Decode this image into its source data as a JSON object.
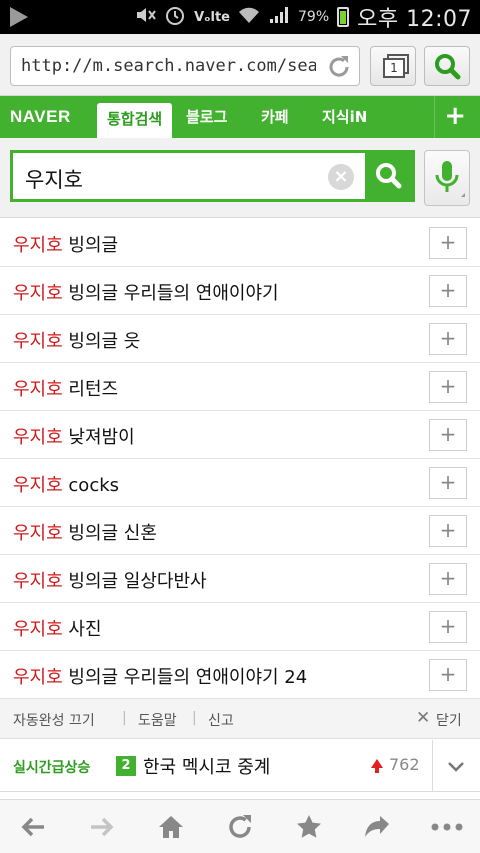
{
  "statusbar": {
    "battery": "79%",
    "carrier": "Vₒlte",
    "time": "오후 12:07"
  },
  "browser": {
    "url": "http://m.search.naver.com/sear…",
    "tab_count": "1"
  },
  "navbar": {
    "logo": "NAVER",
    "tabs": [
      {
        "label": "통합검색"
      },
      {
        "label": "블로그"
      },
      {
        "label": "카페"
      },
      {
        "label": "지식iN"
      }
    ],
    "plus": "+"
  },
  "search": {
    "query": "우지호",
    "clear": "×"
  },
  "suggestions": [
    {
      "keyword": "우지호",
      "rest": " 빙의글"
    },
    {
      "keyword": "우지호",
      "rest": " 빙의글 우리들의 연애이야기"
    },
    {
      "keyword": "우지호",
      "rest": " 빙의글 읏"
    },
    {
      "keyword": "우지호",
      "rest": " 리턴즈"
    },
    {
      "keyword": "우지호",
      "rest": " 낮져밤이"
    },
    {
      "keyword": "우지호",
      "rest": " cocks"
    },
    {
      "keyword": "우지호",
      "rest": " 빙의글 신혼"
    },
    {
      "keyword": "우지호",
      "rest": " 빙의글 일상다반사"
    },
    {
      "keyword": "우지호",
      "rest": " 사진"
    },
    {
      "keyword": "우지호",
      "rest": " 빙의글 우리들의 연애이야기 24"
    }
  ],
  "add_label": "+",
  "footer": {
    "autocomplete_off": "자동완성 끄기",
    "help": "도움말",
    "report": "신고",
    "close_icon": "✕",
    "close": "닫기"
  },
  "trend": {
    "label": "실시간급상승",
    "rank": "2",
    "text": "한국 멕시코 중계",
    "count": "762"
  },
  "colors": {
    "brand_green": "#42b12f",
    "keyword_red": "#d11818"
  }
}
